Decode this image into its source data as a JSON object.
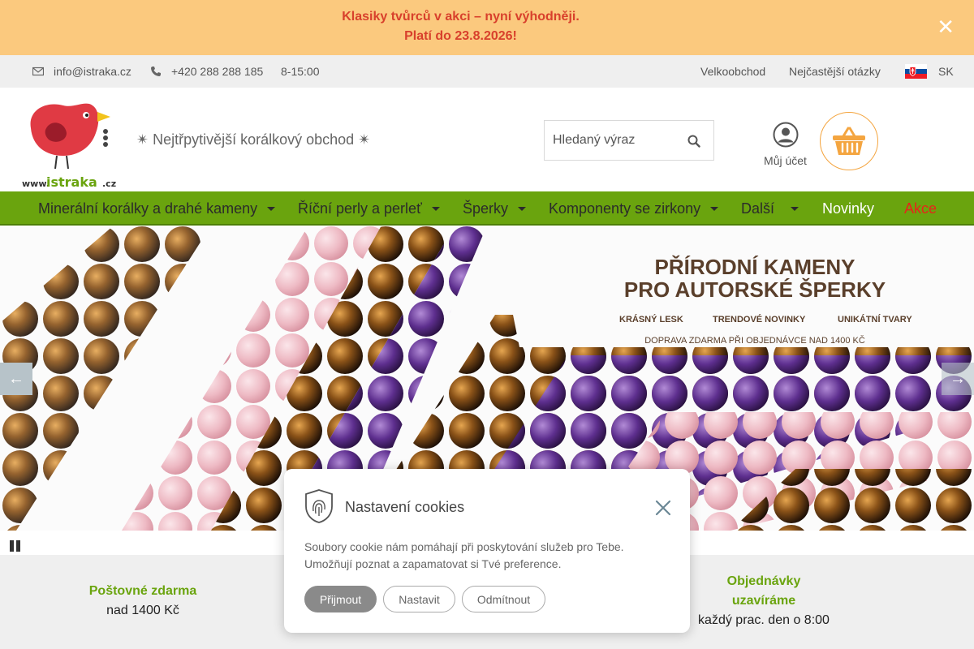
{
  "promo": {
    "line1": "Klasiky tvůrců v akci – nyní výhodněji.",
    "line2": "Platí do 23.8.2026!",
    "close_label": "✕"
  },
  "topbar": {
    "email": "info@istraka.cz",
    "phone": "+420 288 288 185",
    "hours": "8-15:00",
    "links": [
      "Velkoobchod",
      "Nejčastější otázky"
    ],
    "language": "SK"
  },
  "header": {
    "logo_text": "www.istraka.cz",
    "tagline": "✴ Nejtřpytivější korálkový obchod ✴",
    "search_placeholder": "Hledaný výraz",
    "account_label": "Můj účet"
  },
  "nav": {
    "items": [
      {
        "label": "Minerální korálky a drahé kameny",
        "dropdown": true
      },
      {
        "label": "Říční perly a perleť",
        "dropdown": true
      },
      {
        "label": "Šperky",
        "dropdown": true
      },
      {
        "label": "Komponenty se zirkony",
        "dropdown": true
      },
      {
        "label": "Další",
        "dropdown": true
      },
      {
        "label": "Novinky",
        "dropdown": false
      },
      {
        "label": "Akce",
        "dropdown": false
      }
    ]
  },
  "banner": {
    "title1": "PŘÍRODNÍ KAMENY",
    "title2": "PRO AUTORSKÉ ŠPERKY",
    "features": [
      "KRÁSNÝ LESK",
      "TRENDOVÉ NOVINKY",
      "UNIKÁTNÍ TVARY"
    ],
    "shipping": "DOPRAVA ZDARMA PŘI OBJEDNÁVCE NAD 1400 KČ",
    "prev_label": "←",
    "next_label": "→"
  },
  "benefits": [
    {
      "title": "Poštovné zdarma",
      "desc": "nad 1400 Kč"
    },
    {
      "title": "Objednávky uzavíráme",
      "desc": "každý prac. den o 8:00"
    }
  ],
  "cookies": {
    "title": "Nastavení cookies",
    "text": "Soubory cookie nám pomáhají při poskytování služeb pro Tebe. Umožňují poznat a zapamatovat si Tvé preference.",
    "accept": "Přijmout",
    "settings": "Nastavit",
    "reject": "Odmítnout"
  },
  "colors": {
    "promo_bg": "#fbc97e",
    "promo_text": "#d8402c",
    "nav_bg": "#6aa40e",
    "accent_green": "#6aa40e",
    "akce_red": "#e8241a",
    "cart_orange": "#f4a540"
  }
}
